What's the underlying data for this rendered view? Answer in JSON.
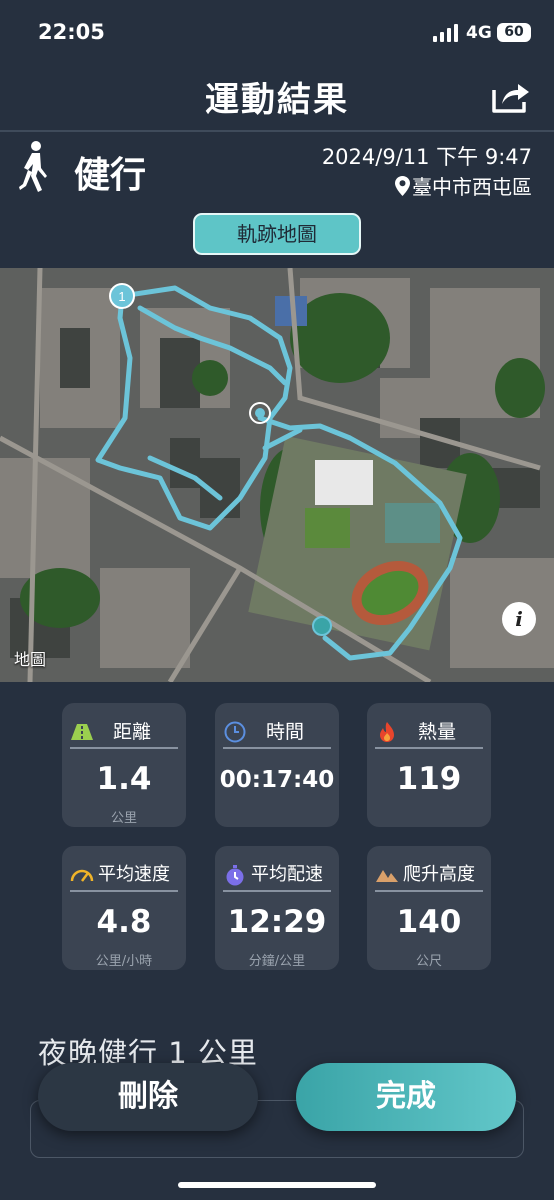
{
  "status_bar": {
    "time": "22:05",
    "network": "4G",
    "battery": "60"
  },
  "header": {
    "title": "運動結果",
    "share_icon": "share-icon"
  },
  "activity": {
    "type": "健行",
    "icon": "walker-icon",
    "datetime": "2024/9/11 下午 9:47",
    "location": "臺中市西屯區"
  },
  "map_tab": {
    "label": "軌跡地圖"
  },
  "map": {
    "start_marker": "1",
    "attribution": "地圖",
    "info_label": "i",
    "route_color": "#6cc4d9"
  },
  "stats": [
    {
      "label": "距離",
      "value": "1.4",
      "unit": "公里",
      "icon": "road-icon"
    },
    {
      "label": "時間",
      "value": "00:17:40",
      "unit": "",
      "icon": "clock-icon"
    },
    {
      "label": "熱量",
      "value": "119",
      "unit": "",
      "icon": "flame-icon"
    },
    {
      "label": "平均速度",
      "value": "4.8",
      "unit": "公里/小時",
      "icon": "speedometer-icon"
    },
    {
      "label": "平均配速",
      "value": "12:29",
      "unit": "分鐘/公里",
      "icon": "stopwatch-icon"
    },
    {
      "label": "爬升高度",
      "value": "140",
      "unit": "公尺",
      "icon": "mountain-icon"
    }
  ],
  "workout_name": "夜晚健行 1 公里",
  "buttons": {
    "delete": "刪除",
    "done": "完成"
  },
  "colors": {
    "background": "#26303f",
    "card": "#3b4452",
    "accent": "#5ec5c7"
  }
}
